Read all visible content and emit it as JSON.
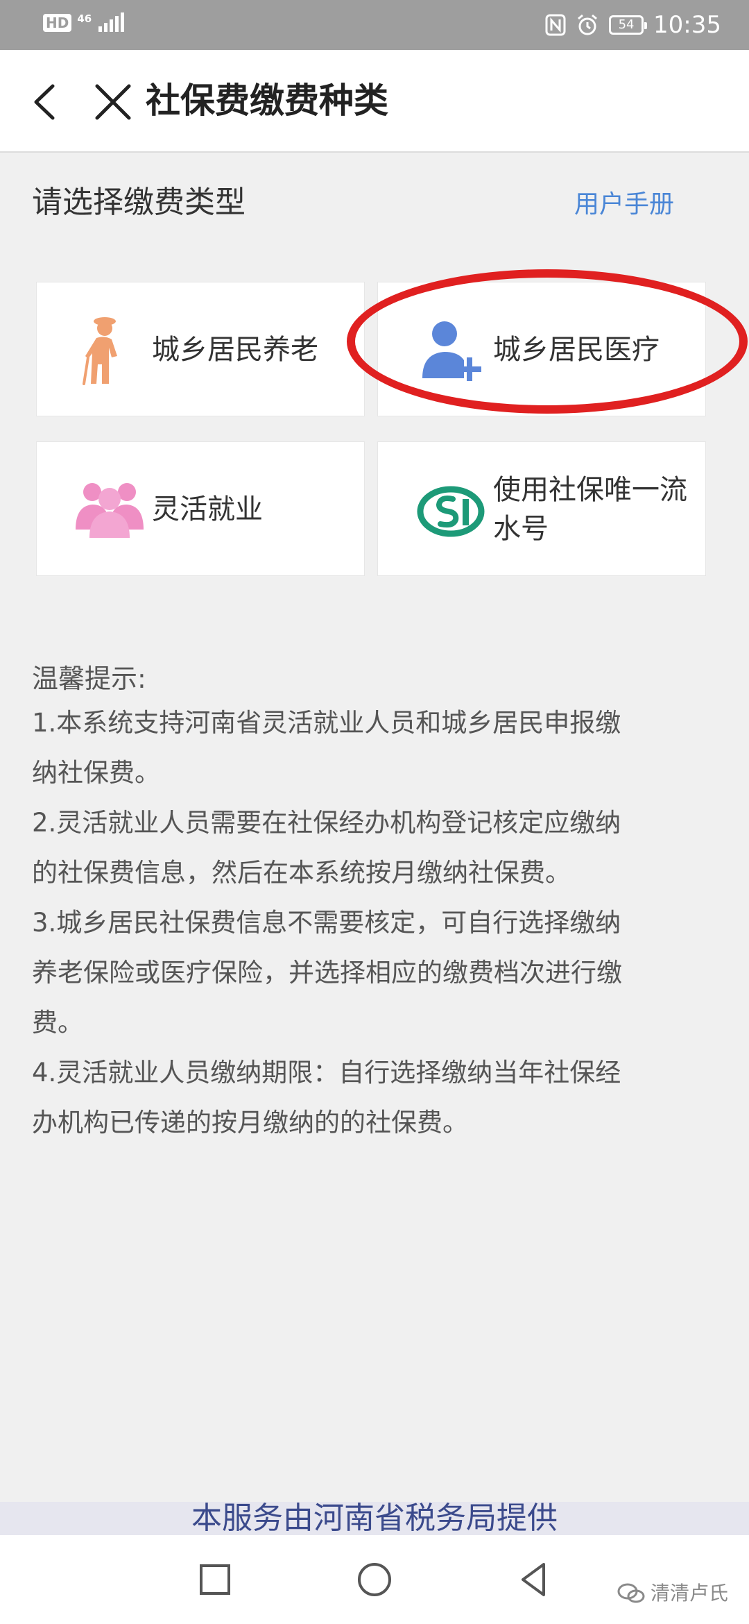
{
  "status_bar": {
    "hd": "HD",
    "network": "46",
    "battery": "54",
    "time": "10:35"
  },
  "title_bar": {
    "title": "社保费缴费种类"
  },
  "section": {
    "title": "请选择缴费类型",
    "manual_link": "用户手册"
  },
  "options": [
    {
      "label": "城乡居民养老",
      "icon": "elderly-person-icon",
      "color": "#f0a070"
    },
    {
      "label": "城乡居民医疗",
      "icon": "user-plus-icon",
      "color": "#5b86d9"
    },
    {
      "label": "灵活就业",
      "icon": "people-group-icon",
      "color": "#ef8fc4"
    },
    {
      "label": "使用社保唯一流水号",
      "icon": "social-security-logo-icon",
      "color": "#1d9a78"
    }
  ],
  "tips": {
    "title": "温馨提示:",
    "lines": [
      "1.本系统支持河南省灵活就业人员和城乡居民申报缴",
      "纳社保费。",
      "2.灵活就业人员需要在社保经办机构登记核定应缴纳",
      "的社保费信息，然后在本系统按月缴纳社保费。",
      "3.城乡居民社保费信息不需要核定，可自行选择缴纳",
      "养老保险或医疗保险，并选择相应的缴费档次进行缴",
      "费。",
      "4.灵活就业人员缴纳期限：自行选择缴纳当年社保经",
      "办机构已传递的按月缴纳的的社保费。"
    ]
  },
  "footer": {
    "text": "本服务由河南省税务局提供"
  },
  "watermark": {
    "text": "清清卢氏"
  },
  "colors": {
    "link": "#4a86d6",
    "highlight": "#e02020",
    "footer_text": "#3b4a8c"
  }
}
